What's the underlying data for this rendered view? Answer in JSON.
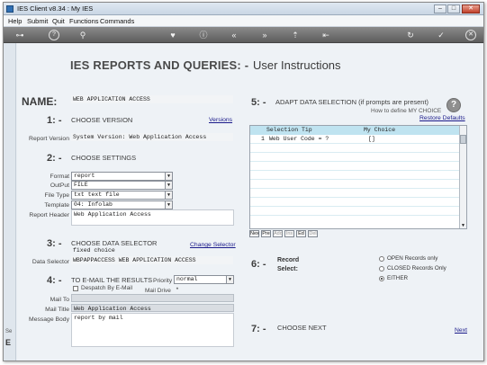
{
  "window": {
    "title": "IES Client v8.34 : My IES",
    "minimize": "–",
    "maximize": "□",
    "close": "✕"
  },
  "menu": [
    "Help",
    "Submit",
    "Quit",
    "Functions",
    "Commands"
  ],
  "toolbar": {
    "icons": [
      "key-icon",
      "help-icon",
      "search-icon",
      "heart-icon",
      "info-icon",
      "rewind-icon",
      "fast-forward-icon",
      "upload-icon",
      "first-icon",
      "refresh-icon",
      "check-icon",
      "close-circle-icon"
    ],
    "glyphs": [
      "⊶",
      "?",
      "⚲",
      "♥",
      "ⓘ",
      "«",
      "»",
      "⇡",
      "⇤",
      "↻",
      "✓",
      "✕"
    ]
  },
  "page": {
    "title": "IES REPORTS AND QUERIES: -",
    "subtitle": "User Instructions",
    "name_label": "NAME:",
    "name_value": "WEB APPLICATION ACCESS"
  },
  "section1": {
    "num": "1: -",
    "title": "CHOOSE VERSION",
    "link": "Versions",
    "label": "Report Version",
    "value": "System Version: Web Application Access"
  },
  "section2": {
    "num": "2: -",
    "title": "CHOOSE SETTINGS",
    "fields": [
      {
        "label": "Format",
        "value": "report"
      },
      {
        "label": "OutPut",
        "value": "FILE"
      },
      {
        "label": "File Type",
        "value": "txt text file"
      },
      {
        "label": "Template",
        "value": "04: Infolab"
      }
    ],
    "header_label": "Report Header",
    "header_value": "Web Application Access"
  },
  "section3": {
    "num": "3: -",
    "title": "CHOOSE DATA SELECTOR",
    "link": "Change Selector",
    "choice": "fixed choice",
    "label": "Data Selector",
    "value": "WBPAPPACCESS WEB APPLICATION ACCESS"
  },
  "section4": {
    "num": "4: -",
    "title": "TO e-MAIL THE RESULTS",
    "priority_label": "Priority",
    "priority_value": "normal",
    "despatch_label": "Despatch By E-Mail",
    "mail_drive_label": "Mail Drive",
    "mail_drive_value": "*",
    "mail_to_label": "Mail To",
    "mail_to_value": "",
    "mail_title_label": "Mail Title",
    "mail_title_value": "Web Application Access",
    "message_label": "Message Body",
    "message_value": "report by mail"
  },
  "section5": {
    "num": "5: -",
    "title": "ADAPT DATA SELECTION (if prompts are present)",
    "help_link": "How to define MY CHOICE",
    "restore_link": "Restore Defaults",
    "col_tip": "Selection Tip",
    "col_choice": "My Choice",
    "rows": [
      {
        "n": "1",
        "tip": "Web User Code = ?",
        "choice": "[]"
      }
    ],
    "grid_buttons": [
      "Nex",
      "Pre",
      "Add",
      "Ins",
      "Ed",
      "Del"
    ]
  },
  "section6": {
    "num": "6: -",
    "title_line1": "Record",
    "title_line2": "Select:",
    "options": [
      "OPEN Records only",
      "CLOSED Records Only",
      "EITHER"
    ],
    "selected": 2
  },
  "section7": {
    "num": "7: -",
    "title": "CHOOSE NEXT",
    "link": "Next"
  },
  "left_strip": {
    "frag1": "Se",
    "frag2": "E"
  }
}
